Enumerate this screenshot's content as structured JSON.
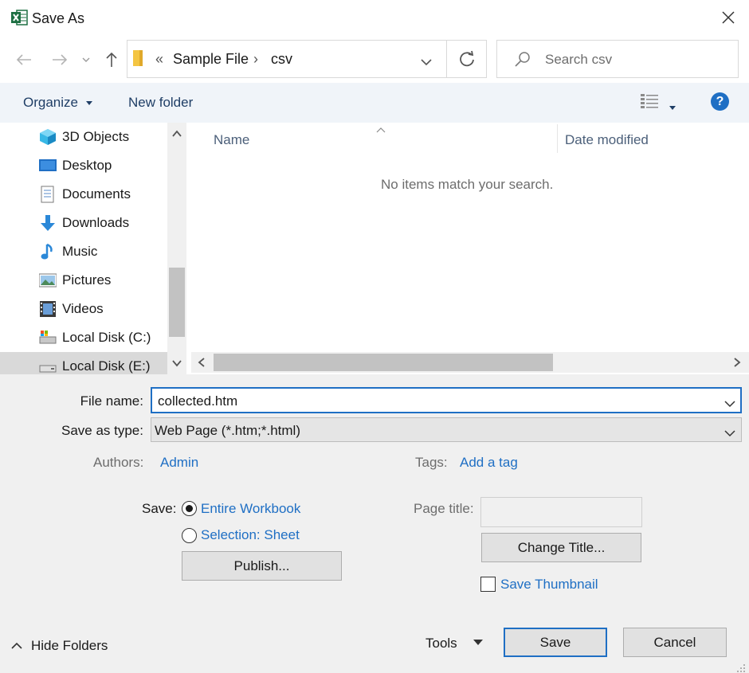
{
  "window": {
    "title": "Save As"
  },
  "address": {
    "overflow": "«",
    "crumbs": [
      "Sample File",
      "csv"
    ]
  },
  "search": {
    "placeholder": "Search csv"
  },
  "toolbar": {
    "organize": "Organize",
    "new_folder": "New folder",
    "help": "?"
  },
  "nav_items": [
    "3D Objects",
    "Desktop",
    "Documents",
    "Downloads",
    "Music",
    "Pictures",
    "Videos",
    "Local Disk (C:)",
    "Local Disk (E:)"
  ],
  "columns": {
    "name": "Name",
    "date_modified": "Date modified"
  },
  "empty_message": "No items match your search.",
  "form": {
    "file_name_label": "File name:",
    "file_name_value": "collected.htm",
    "save_type_label": "Save as type:",
    "save_type_value": "Web Page (*.htm;*.html)",
    "authors_label": "Authors:",
    "authors_value": "Admin",
    "tags_label": "Tags:",
    "tags_value": "Add a tag",
    "save_label": "Save:",
    "radio_entire": "Entire Workbook",
    "radio_selection": "Selection: Sheet",
    "publish": "Publish...",
    "page_title_label": "Page title:",
    "change_title": "Change Title...",
    "save_thumbnail": "Save Thumbnail"
  },
  "footer": {
    "hide_folders": "Hide Folders",
    "tools": "Tools",
    "save": "Save",
    "cancel": "Cancel"
  },
  "colors": {
    "accent": "#1f6fc4",
    "excel_green": "#1d6f42",
    "folder_yellow": "#f4c542"
  }
}
